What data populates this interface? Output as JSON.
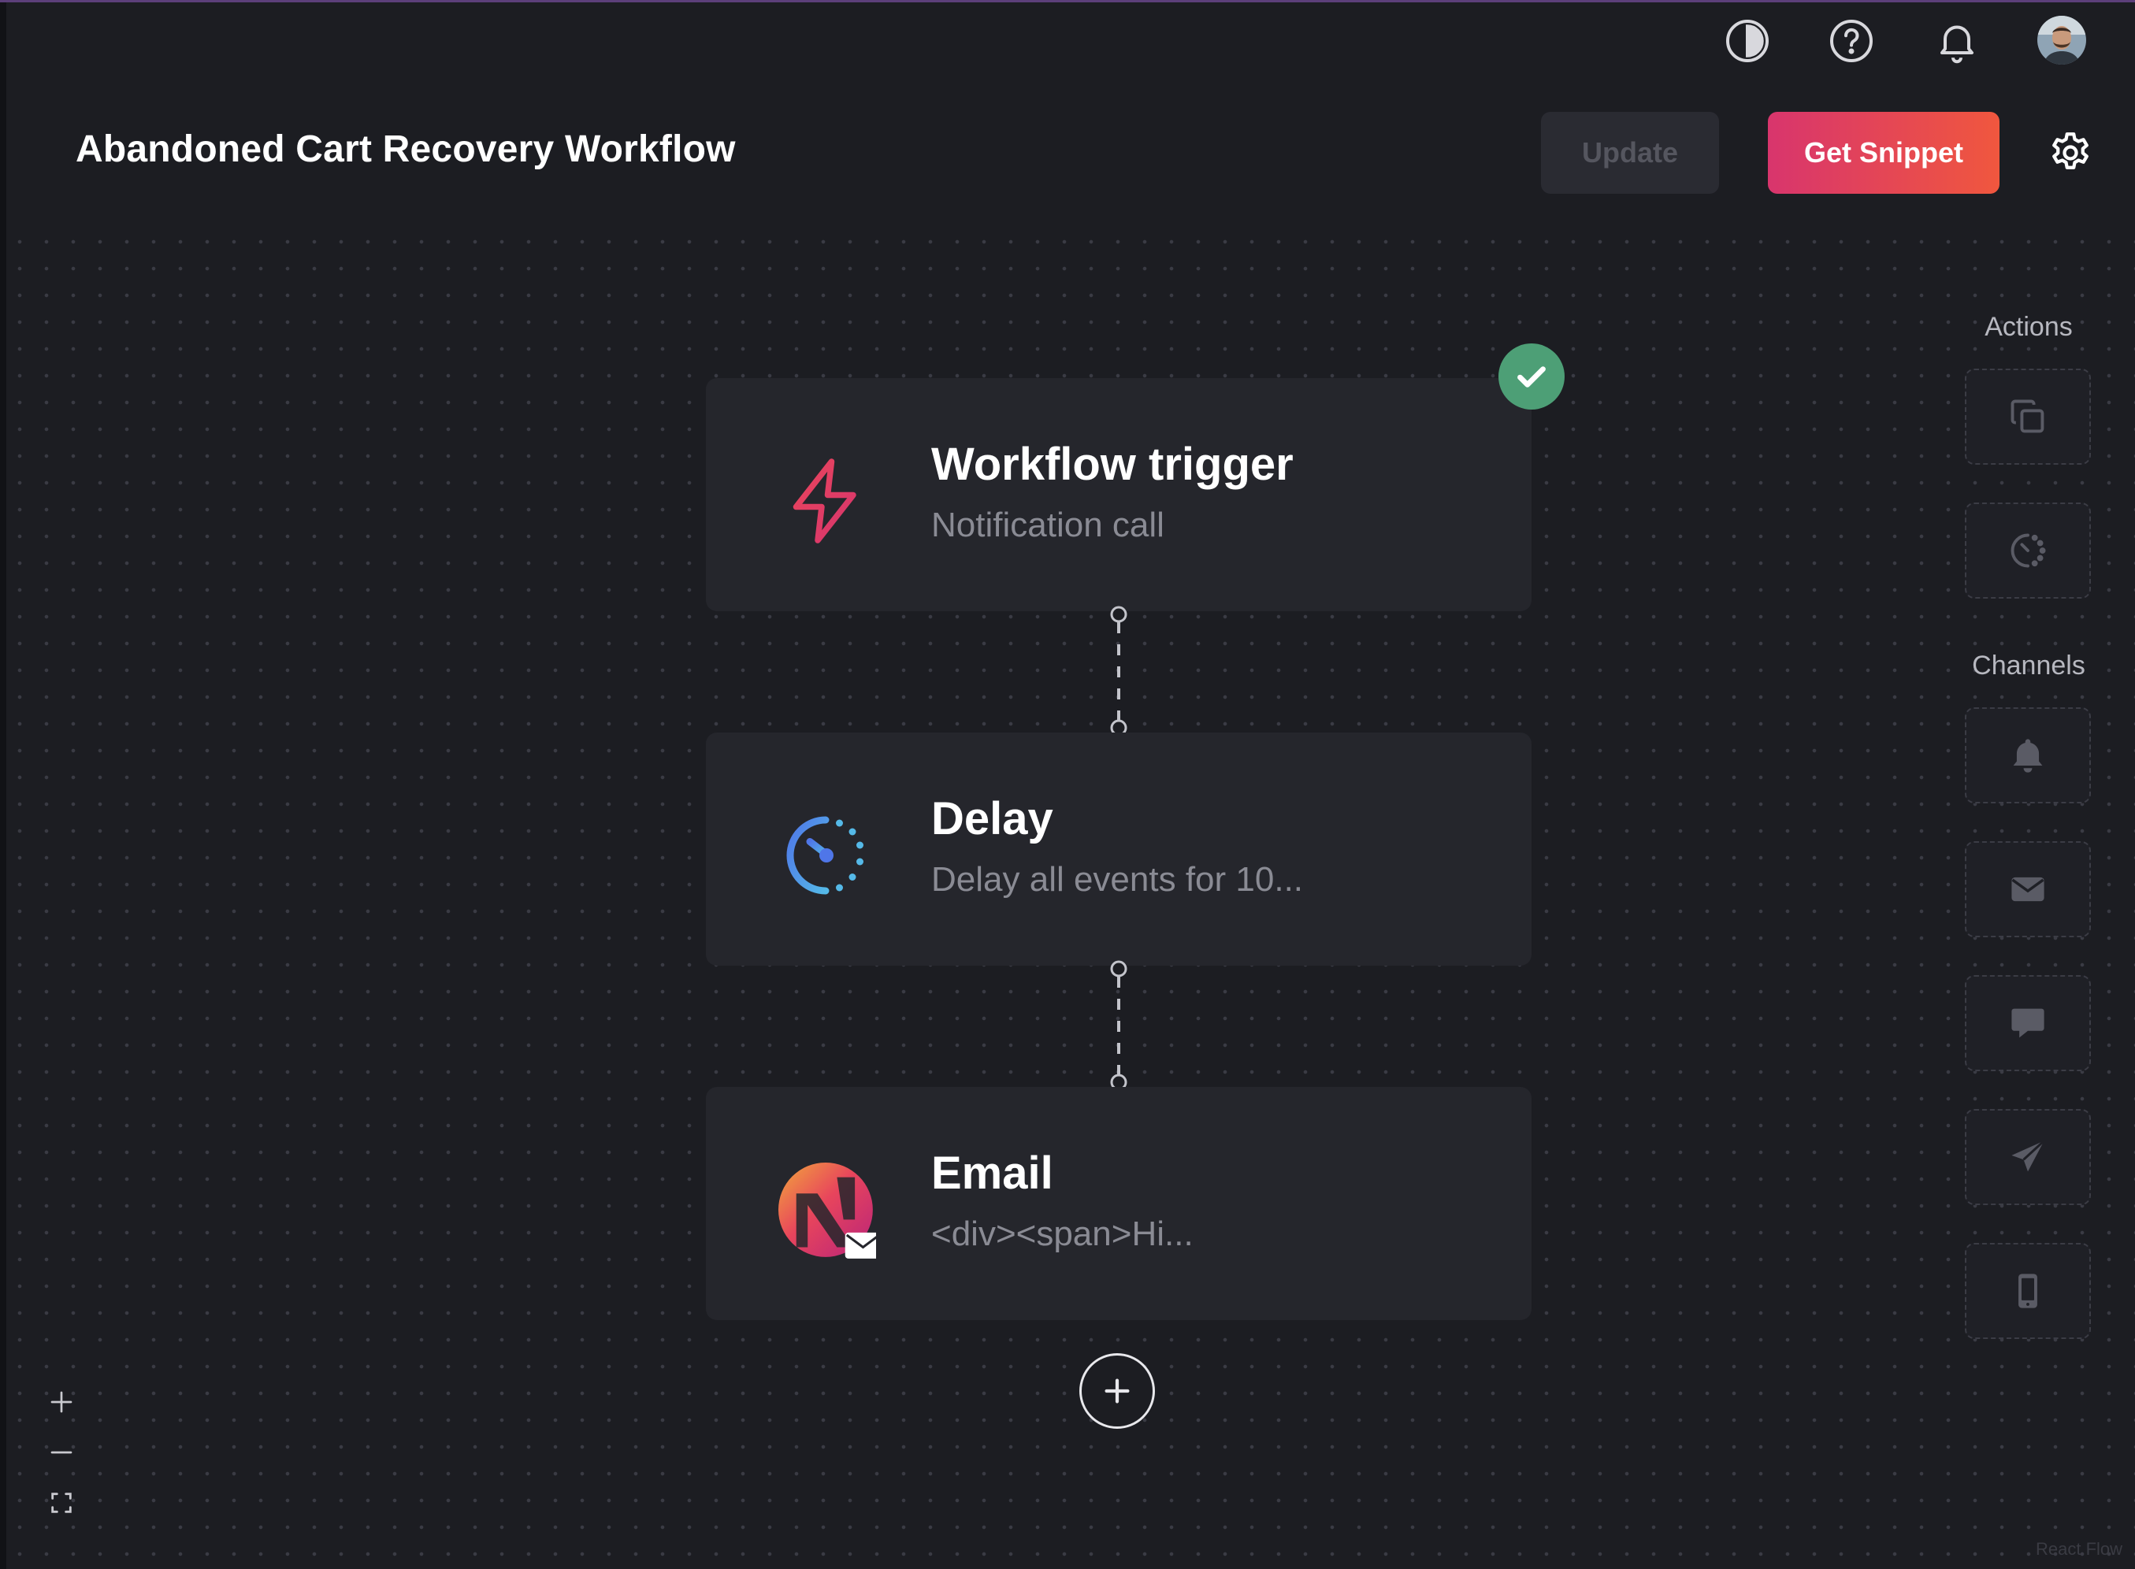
{
  "header": {
    "title": "Abandoned Cart Recovery Workflow",
    "update_label": "Update",
    "snippet_label": "Get Snippet"
  },
  "topbar": {
    "icons": [
      "theme-toggle-icon",
      "help-icon",
      "bell-icon",
      "avatar"
    ]
  },
  "nodes": [
    {
      "title": "Workflow trigger",
      "subtitle": "Notification call",
      "icon": "lightning-icon",
      "status": "completed"
    },
    {
      "title": "Delay",
      "subtitle": "Delay all events for 10...",
      "icon": "timer-icon"
    },
    {
      "title": "Email",
      "subtitle": "<div><span>Hi...",
      "icon": "email-channel-icon"
    }
  ],
  "sidebar": {
    "actions_label": "Actions",
    "channels_label": "Channels",
    "actions": [
      "copy-icon",
      "timer-icon"
    ],
    "channels": [
      "bell-icon",
      "envelope-icon",
      "chat-icon",
      "send-icon",
      "mobile-icon"
    ]
  },
  "canvas": {
    "attribution": "React Flow"
  },
  "colors": {
    "background": "#1c1d22",
    "node_bg": "#25262c",
    "accent_gradient_start": "#d8356d",
    "accent_gradient_end": "#f0573e",
    "success": "#4d9f76"
  }
}
